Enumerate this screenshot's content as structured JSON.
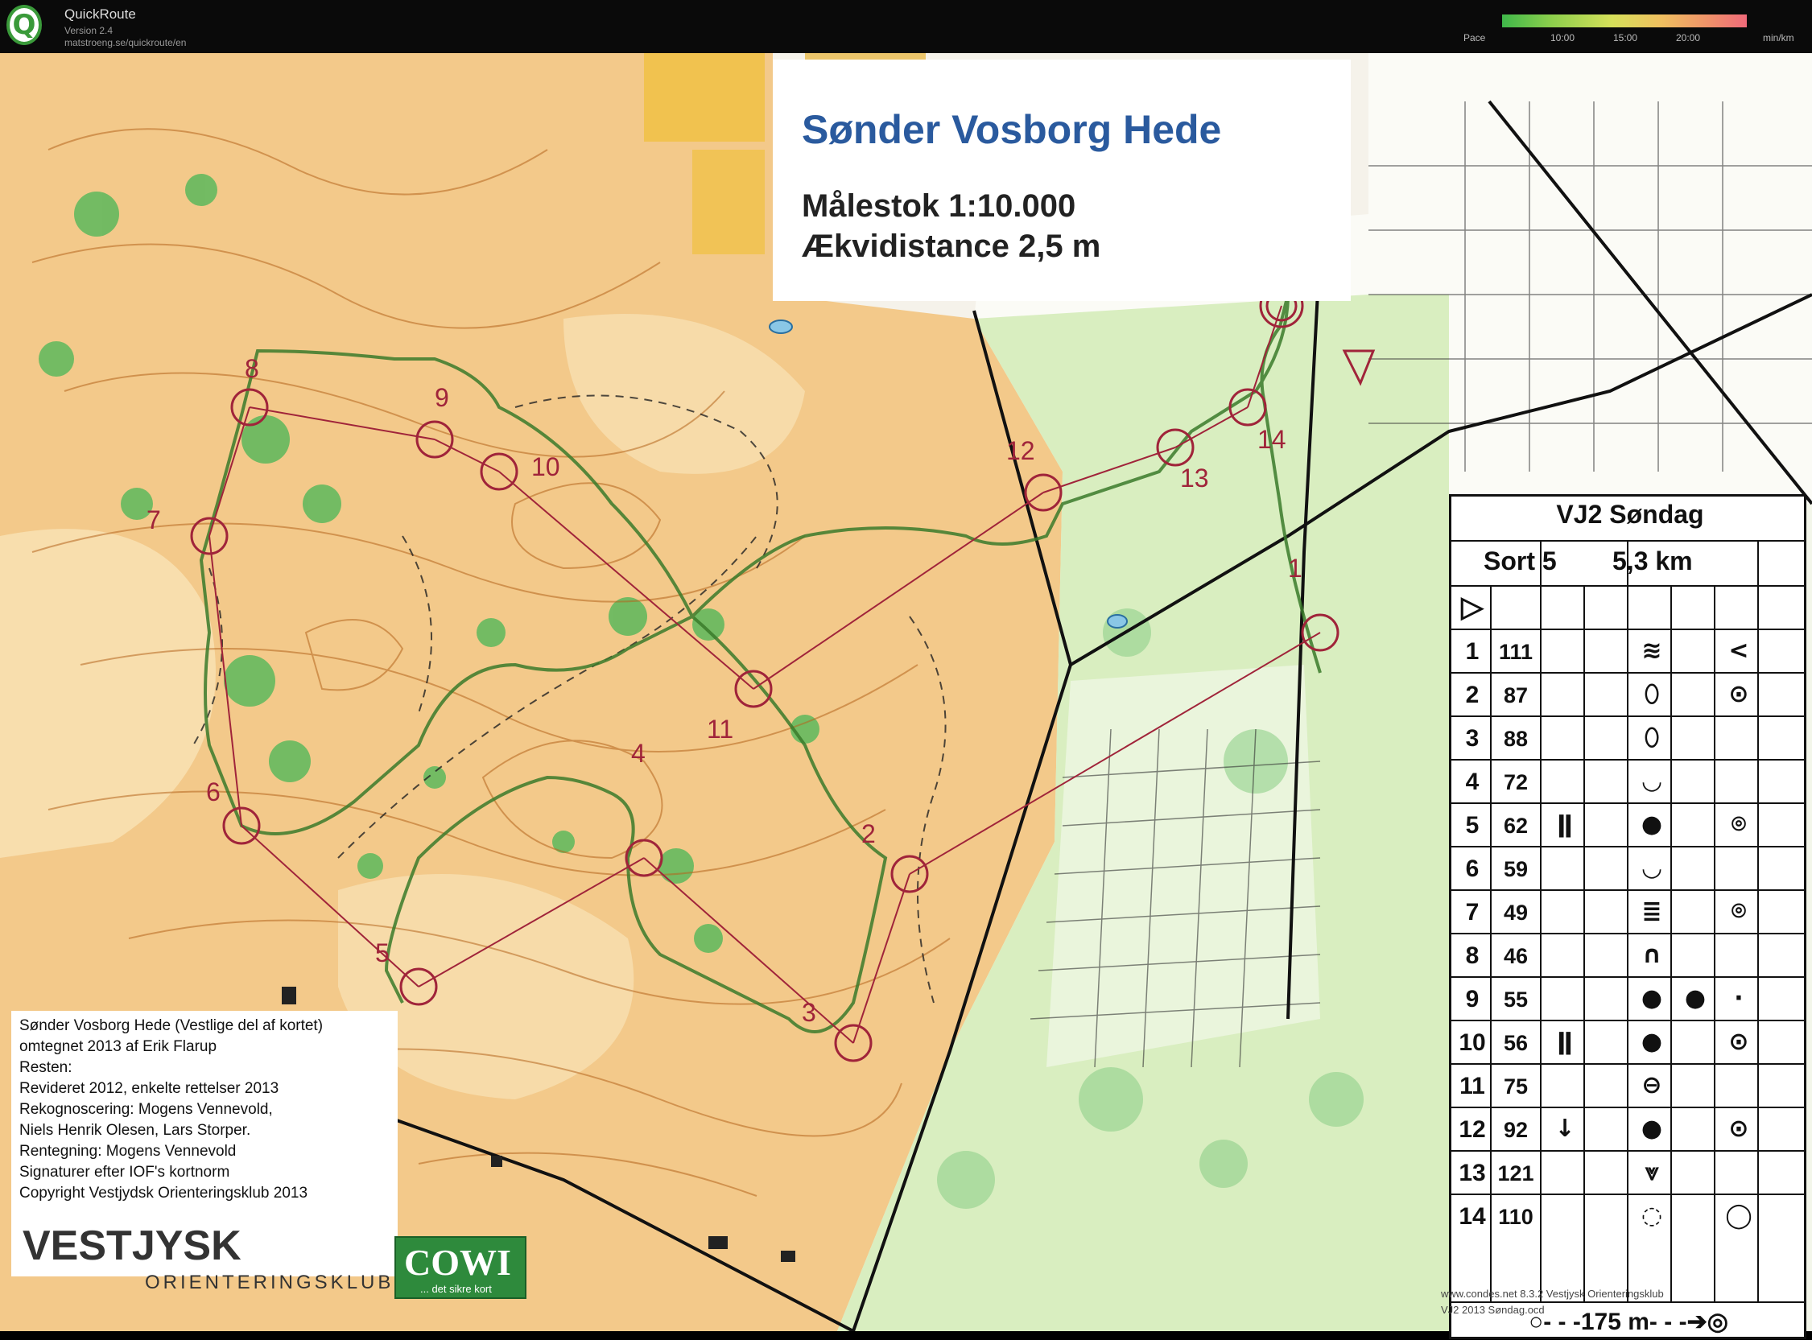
{
  "app": {
    "name": "QuickRoute",
    "version": "Version 2.4",
    "url": "matstroeng.se/quickroute/en",
    "logo_letter": "Q"
  },
  "pace": {
    "label": "Pace",
    "ticks": [
      "10:00",
      "15:00",
      "20:00"
    ],
    "unit": "min/km"
  },
  "map": {
    "title": "Sønder Vosborg Hede",
    "scale": "Målestok 1:10.000",
    "contour": "Ækvidistance 2,5 m",
    "colors": {
      "open": "#f3c98a",
      "rough": "#f8e0b0",
      "forest_green": "#5cb85c",
      "light_green": "#c8e6a0",
      "yellow": "#f0c040",
      "contour": "#b5651d",
      "course": "#a0243a",
      "route": "#3a7a2a",
      "road": "#111111"
    }
  },
  "credits": [
    "Sønder Vosborg Hede (Vestlige del af kortet)",
    "omtegnet 2013 af Erik Flarup",
    "Resten:",
    "Revideret 2012, enkelte rettelser 2013",
    "Rekognoscering: Mogens Vennevold,",
    "Niels Henrik Olesen, Lars Storper.",
    "Rentegning: Mogens Vennevold",
    "Signaturer efter IOF's kortnorm",
    "Copyright Vestjydsk Orienteringsklub 2013"
  ],
  "club": {
    "name": "VESTJYSK",
    "sub": "ORIENTERINGSKLUB"
  },
  "sponsor": {
    "name": "COWI",
    "tag": "... det sikre kort"
  },
  "controls": [
    {
      "label": "1"
    },
    {
      "label": "2"
    },
    {
      "label": "3"
    },
    {
      "label": "4"
    },
    {
      "label": "5"
    },
    {
      "label": "6"
    },
    {
      "label": "7"
    },
    {
      "label": "8"
    },
    {
      "label": "9"
    },
    {
      "label": "10"
    },
    {
      "label": "11"
    },
    {
      "label": "12"
    },
    {
      "label": "13"
    },
    {
      "label": "14"
    }
  ],
  "description_sheet": {
    "title": "VJ2 Søndag",
    "class": "Sort 5",
    "length": "5,3 km",
    "start_symbol": "▷",
    "rows": [
      {
        "num": "1",
        "code": "111",
        "c": "",
        "d": "",
        "e": "≋",
        "f": "",
        "g": "<"
      },
      {
        "num": "2",
        "code": "87",
        "c": "",
        "d": "",
        "e": "⬯",
        "f": "",
        "g": "⊙"
      },
      {
        "num": "3",
        "code": "88",
        "c": "",
        "d": "",
        "e": "⬯",
        "f": "",
        "g": ""
      },
      {
        "num": "4",
        "code": "72",
        "c": "",
        "d": "",
        "e": "◡",
        "f": "",
        "g": ""
      },
      {
        "num": "5",
        "code": "62",
        "c": "ǁ",
        "d": "",
        "e": "●",
        "f": "",
        "g": "⌾"
      },
      {
        "num": "6",
        "code": "59",
        "c": "",
        "d": "",
        "e": "◡",
        "f": "",
        "g": ""
      },
      {
        "num": "7",
        "code": "49",
        "c": "",
        "d": "",
        "e": "≣",
        "f": "",
        "g": "⌾"
      },
      {
        "num": "8",
        "code": "46",
        "c": "",
        "d": "",
        "e": "∩",
        "f": "",
        "g": ""
      },
      {
        "num": "9",
        "code": "55",
        "c": "",
        "d": "",
        "e": "●",
        "f": "●",
        "g": "⋅"
      },
      {
        "num": "10",
        "code": "56",
        "c": "ǁ",
        "d": "",
        "e": "●",
        "f": "",
        "g": "⊙"
      },
      {
        "num": "11",
        "code": "75",
        "c": "",
        "d": "",
        "e": "⊖",
        "f": "",
        "g": ""
      },
      {
        "num": "12",
        "code": "92",
        "c": "↓",
        "d": "",
        "e": "●",
        "f": "",
        "g": "⊙"
      },
      {
        "num": "13",
        "code": "121",
        "c": "",
        "d": "",
        "e": "⩔",
        "f": "",
        "g": ""
      },
      {
        "num": "14",
        "code": "110",
        "c": "",
        "d": "",
        "e": "◌",
        "f": "",
        "g": "◯"
      }
    ],
    "finish": "○- - -175 m- - -➔◎"
  },
  "footnote": "www.condes.net 8.3.2 Vestjysk Orienteringsklub",
  "footnote2": "VJ2 2013 Søndag.ocd"
}
